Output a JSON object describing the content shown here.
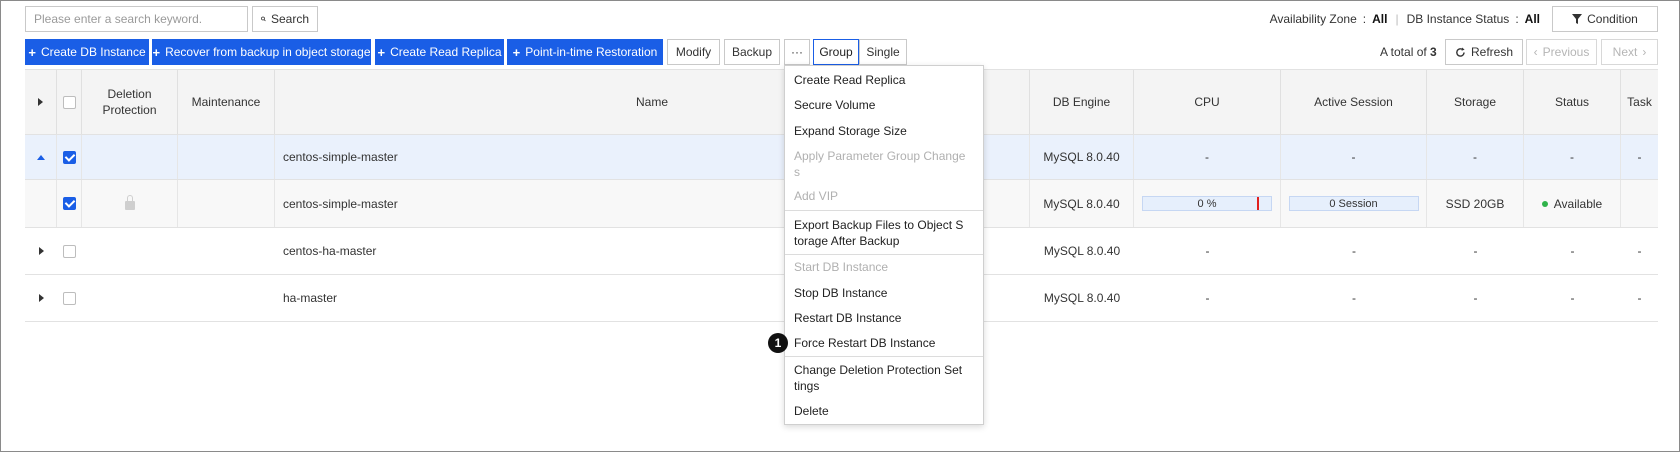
{
  "search": {
    "placeholder": "Please enter a search keyword.",
    "button_label": "Search"
  },
  "toolbar": {
    "create_db_instance": "Create DB Instance",
    "recover_from_backup": "Recover from backup in object storage",
    "create_read_replica": "Create Read Replica",
    "point_in_time_restoration": "Point-in-time Restoration",
    "modify": "Modify",
    "backup": "Backup",
    "more": "···",
    "group": "Group",
    "single": "Single"
  },
  "filters": {
    "availability_zone_label": "Availability Zone",
    "availability_zone_value": "All",
    "db_instance_status_label": "DB Instance Status",
    "db_instance_status_value": "All",
    "separator": ":",
    "condition_button": "Condition"
  },
  "pagination": {
    "total_prefix": "A total of",
    "total_count": "3",
    "refresh": "Refresh",
    "previous": "Previous",
    "next": "Next"
  },
  "table": {
    "columns": {
      "deletion_protection": "Deletion Protection",
      "maintenance": "Maintenance",
      "name": "Name",
      "db_engine": "DB Engine",
      "cpu": "CPU",
      "active_session": "Active Session",
      "storage": "Storage",
      "status": "Status",
      "task": "Task"
    },
    "rows": [
      {
        "name": "centos-simple-master",
        "engine": "MySQL 8.0.40",
        "cpu": "-",
        "session": "-",
        "storage": "-",
        "status": "-",
        "task": "-"
      },
      {
        "name": "centos-simple-master",
        "engine": "MySQL 8.0.40",
        "cpu": "0 %",
        "cpu_fraction": 0.0,
        "session": "0 Session",
        "storage": "SSD 20GB",
        "status": "Available",
        "task": ""
      },
      {
        "name": "centos-ha-master",
        "engine": "MySQL 8.0.40",
        "cpu": "-",
        "session": "-",
        "storage": "-",
        "status": "-",
        "task": "-"
      },
      {
        "name": "ha-master",
        "engine": "MySQL 8.0.40",
        "cpu": "-",
        "session": "-",
        "storage": "-",
        "status": "-",
        "task": "-"
      }
    ]
  },
  "menu": {
    "items": [
      "Create Read Replica",
      "Secure Volume",
      "Expand Storage Size",
      "Apply Parameter Group Change s",
      "Add VIP",
      "Export Backup Files to Object S torage After Backup",
      "Start DB Instance",
      "Stop DB Instance",
      "Restart DB Instance",
      "Force Restart DB Instance",
      "Change Deletion Protection Set tings",
      "Delete"
    ],
    "disabled": [
      "Apply Parameter Group Change s",
      "Add VIP",
      "Start DB Instance"
    ]
  },
  "annotation": {
    "marker": "1"
  },
  "colors": {
    "primary": "#1a5ee6",
    "selected_row": "#eaf1fc",
    "status_available": "#2fb34a",
    "cpu_mark": "#e02020"
  }
}
